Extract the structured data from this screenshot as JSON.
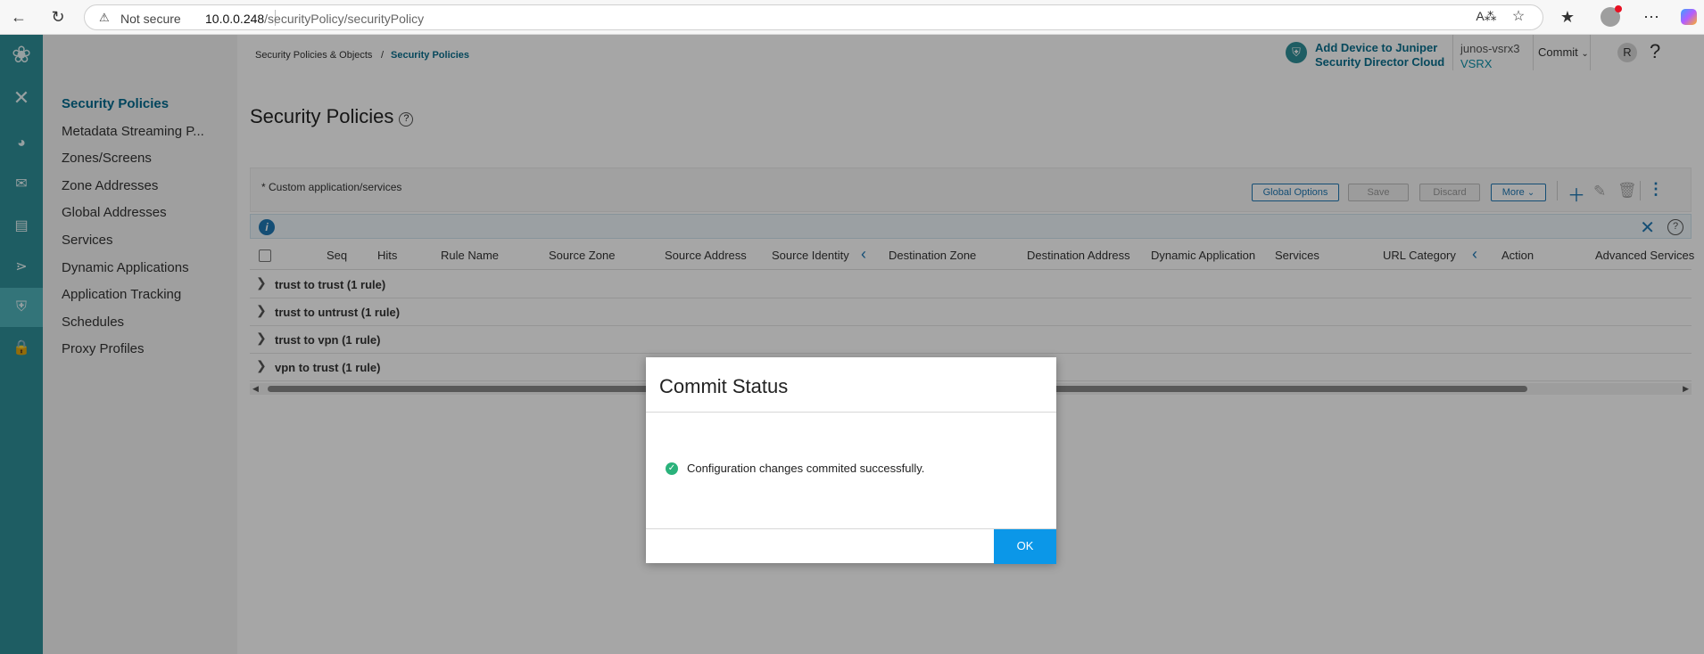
{
  "browser": {
    "security_label": "Not secure",
    "url_host": "10.0.0.248",
    "url_path": "/securityPolicy/securityPolicy",
    "profile_notification_color": "#e81123"
  },
  "header": {
    "add_device_line1": "Add Device to Juniper",
    "add_device_line2": "Security Director Cloud",
    "device_name": "junos-vsrx3",
    "device_type": "VSRX",
    "commit_label": "Commit",
    "user_initial": "R",
    "help_label": "?"
  },
  "breadcrumb": {
    "parent": "Security Policies & Objects",
    "separator": "/",
    "current": "Security Policies"
  },
  "sidebar": {
    "items": [
      {
        "label": "Security Policies",
        "active": true
      },
      {
        "label": "Metadata Streaming P..."
      },
      {
        "label": "Zones/Screens"
      },
      {
        "label": "Zone Addresses"
      },
      {
        "label": "Global Addresses"
      },
      {
        "label": "Services"
      },
      {
        "label": "Dynamic Applications"
      },
      {
        "label": "Application Tracking"
      },
      {
        "label": "Schedules"
      },
      {
        "label": "Proxy Profiles"
      }
    ]
  },
  "page": {
    "title": "Security Policies",
    "custom_note": "* Custom application/services"
  },
  "toolbar": {
    "global_options": "Global Options",
    "save": "Save",
    "discard": "Discard",
    "more": "More"
  },
  "table": {
    "columns": [
      "Seq",
      "Hits",
      "Rule Name",
      "Source Zone",
      "Source Address",
      "Source Identity",
      "Destination Zone",
      "Destination Address",
      "Dynamic Application",
      "Services",
      "URL Category",
      "Action",
      "Advanced Services"
    ],
    "groups": [
      "trust to trust (1 rule)",
      "trust to untrust (1 rule)",
      "trust to vpn (1 rule)",
      "vpn to trust (1 rule)"
    ]
  },
  "dialog": {
    "title": "Commit Status",
    "message": "Configuration changes commited successfully.",
    "ok_label": "OK"
  },
  "colors": {
    "rail": "#2f8f98",
    "accent": "#1f78b4",
    "active_menu": "#006b8f",
    "ok_button": "#0b97e8",
    "success": "#2ab27b"
  }
}
